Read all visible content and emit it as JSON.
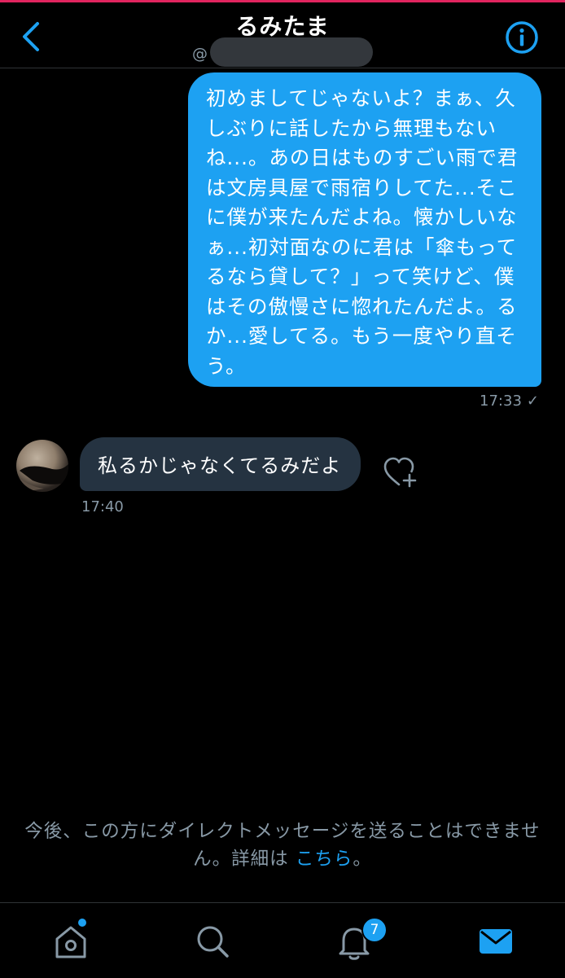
{
  "header": {
    "title": "るみたま",
    "handle_prefix": "@"
  },
  "messages": {
    "sent": {
      "text": "初めましてじゃないよ？まぁ、久しぶりに話したから無理もないね...。あの日はものすごい雨で君は文房具屋で雨宿りしてた...そこに僕が来たんだよね。懐かしいなぁ...初対面なのに君は「傘もってるなら貸して？」って笑けど、僕はその傲慢さに惚れたんだよ。るか...愛してる。もう一度やり直そう。",
      "time": "17:33",
      "status_icon": "✓"
    },
    "received": {
      "text": "私るかじゃなくてるみだよ",
      "time": "17:40"
    }
  },
  "notice": {
    "text": "今後、この方にダイレクトメッセージを送ることはできません。詳細は ",
    "link": "こちら",
    "suffix": "。"
  },
  "tabbar": {
    "notifications_badge": "7",
    "active_tab": "messages"
  },
  "colors": {
    "accent": "#1da1f2",
    "background": "#000000",
    "received_bubble": "#253341",
    "muted_text": "#8899a6"
  },
  "icons": [
    "back-chevron-icon",
    "info-icon",
    "heart-plus-icon",
    "home-icon",
    "search-icon",
    "bell-icon",
    "mail-icon"
  ]
}
